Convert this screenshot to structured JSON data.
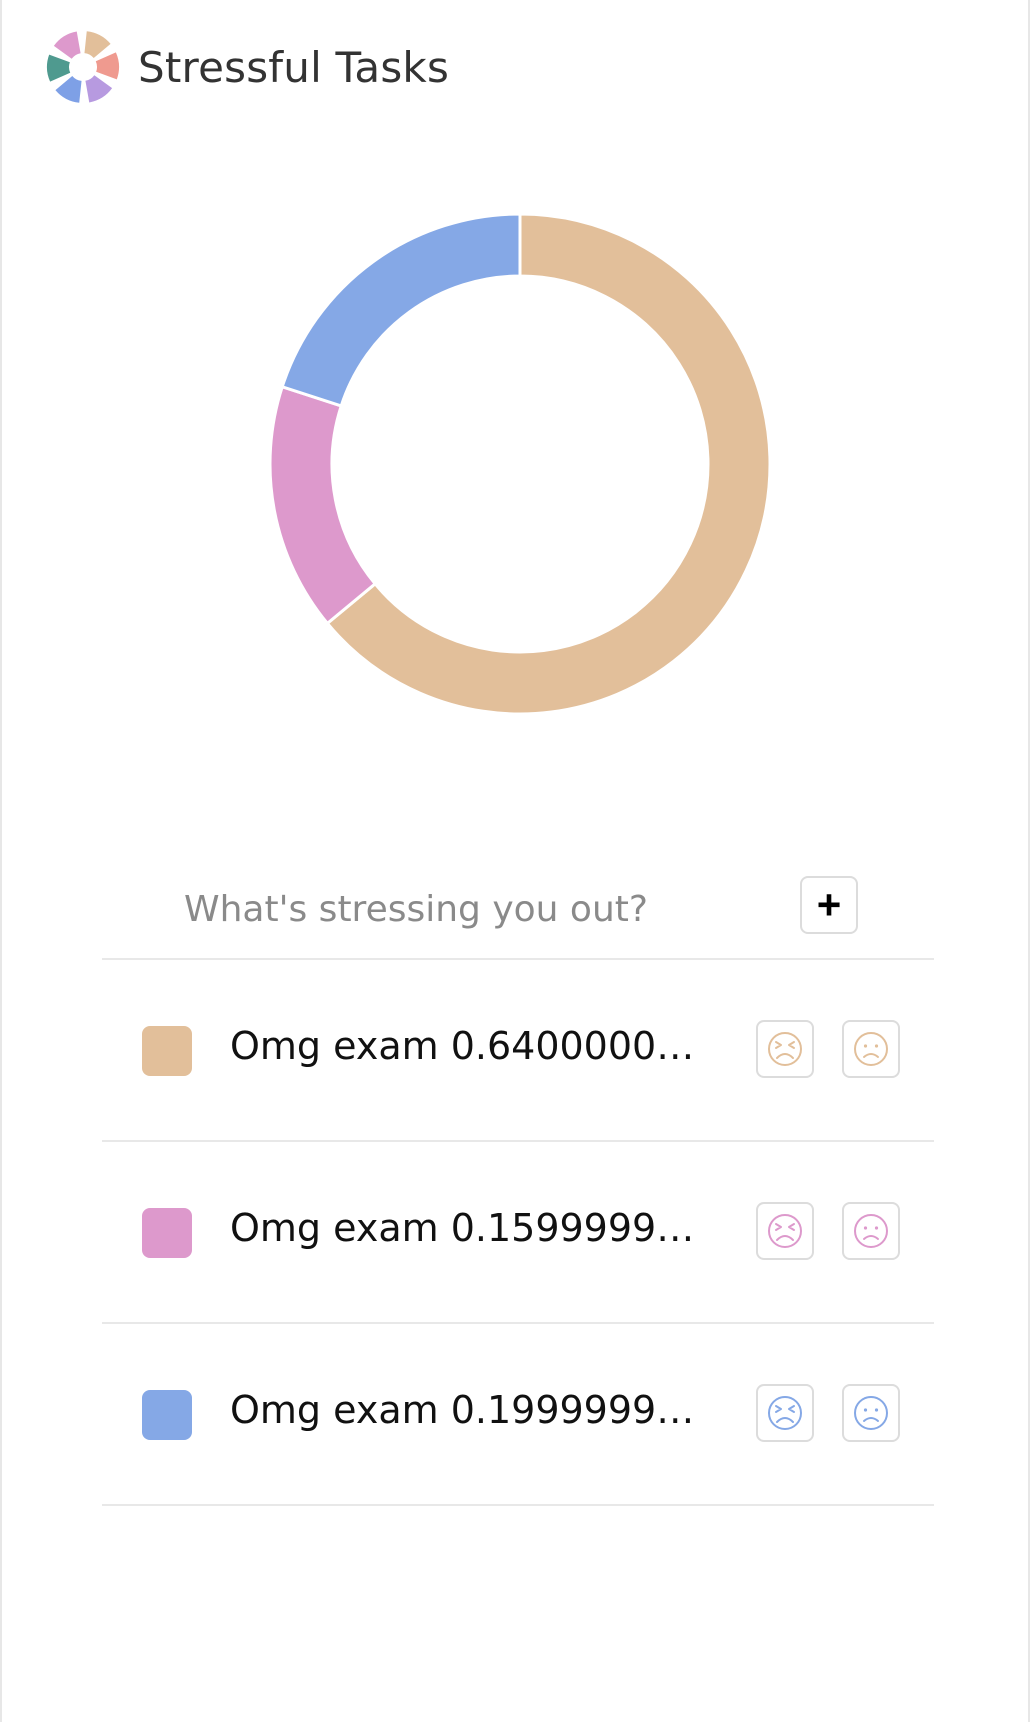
{
  "app": {
    "title": "Stressful Tasks"
  },
  "input": {
    "placeholder": "What's stressing you out?",
    "value": ""
  },
  "add_button": {
    "label": "+"
  },
  "chart_data": {
    "type": "pie",
    "variant": "donut",
    "categories": [
      "Omg exam 0.64000000...",
      "Omg exam 0.15999999...",
      "Omg exam 0.19999999..."
    ],
    "values": [
      0.64,
      0.16,
      0.2
    ],
    "colors": [
      "#e2bf9a",
      "#dd99cc",
      "#85a8e6"
    ],
    "start_angle": "12 o'clock",
    "direction": "clockwise",
    "legend": "none"
  },
  "tasks": [
    {
      "label": "Omg exam 0.64000000...",
      "color": "#e2bf9a",
      "stressed_icon": "stressed-face-icon",
      "meh_icon": "frown-face-icon"
    },
    {
      "label": "Omg exam 0.15999999...",
      "color": "#dd99cc",
      "stressed_icon": "stressed-face-icon",
      "meh_icon": "frown-face-icon"
    },
    {
      "label": "Omg exam 0.19999999...",
      "color": "#85a8e6",
      "stressed_icon": "stressed-face-icon",
      "meh_icon": "frown-face-icon"
    }
  ],
  "logo": {
    "colors": [
      "#e2bf9a",
      "#ef9a8f",
      "#b79ae0",
      "#7ea0e6",
      "#4f9a8f",
      "#dd99cc"
    ]
  }
}
